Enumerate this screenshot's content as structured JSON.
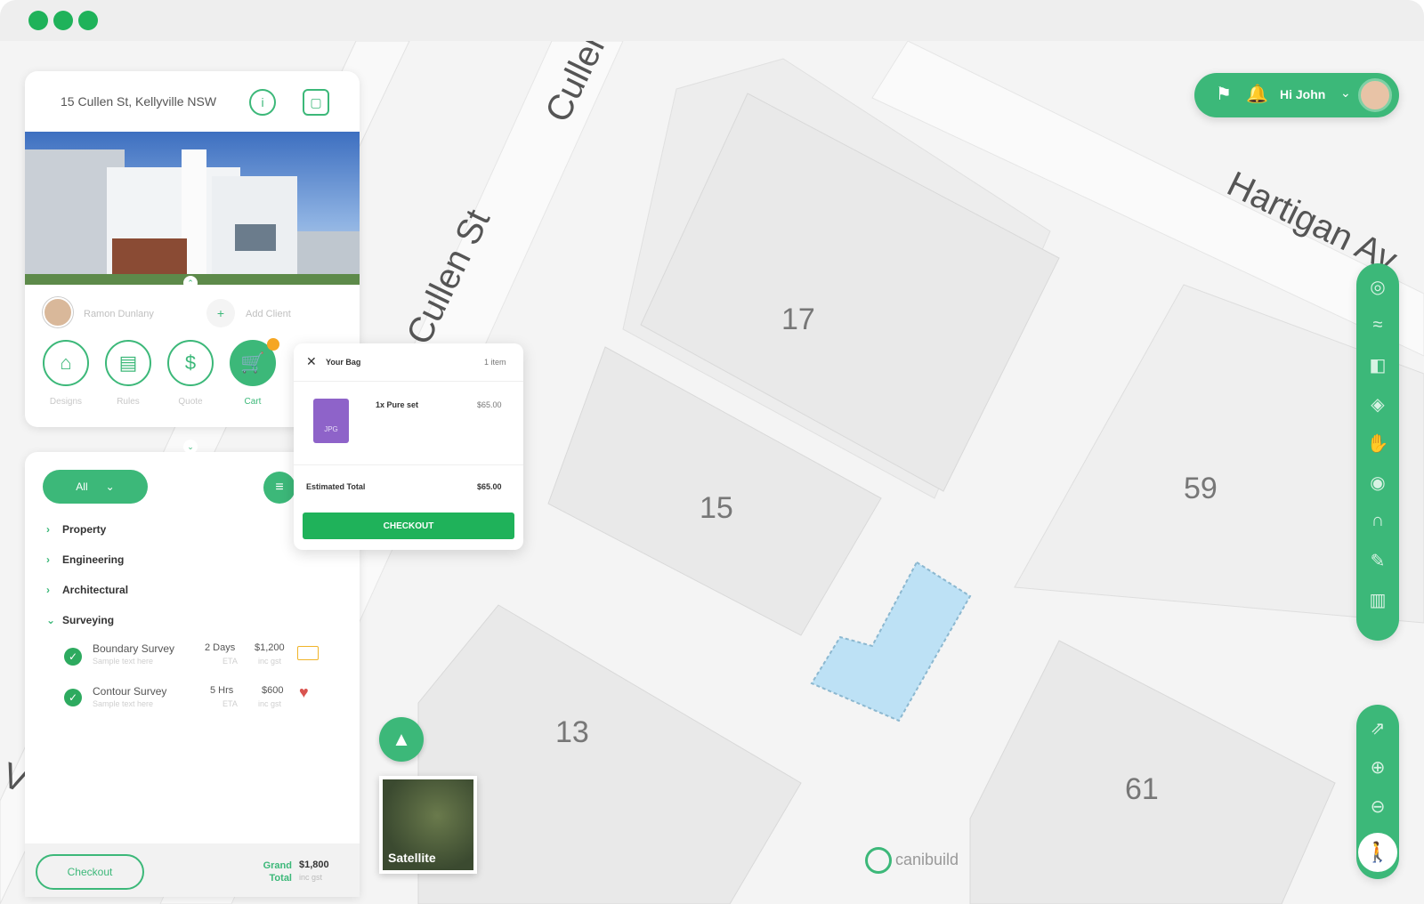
{
  "window": {
    "dots_color": "#1fb25a"
  },
  "map": {
    "streets": [
      "Cullen St",
      "Hartigan Av"
    ],
    "left_fragment": "V",
    "lots": [
      "17",
      "15",
      "59",
      "13",
      "61"
    ],
    "selected_lot_color": "#bde1f5",
    "accent": "#3cb879"
  },
  "property_panel": {
    "address": "15 Cullen St, Kellyville NSW",
    "agent_name": "Ramon Dunlany",
    "add_client_label": "Add Client",
    "tools": [
      {
        "label": "Designs",
        "icon": "house-icon"
      },
      {
        "label": "Rules",
        "icon": "clipboard-icon"
      },
      {
        "label": "Quote",
        "icon": "dollar-icon"
      },
      {
        "label": "Cart",
        "icon": "cart-icon"
      }
    ]
  },
  "services_panel": {
    "filter_label": "All",
    "categories": [
      "Property",
      "Engineering",
      "Architectural",
      "Surveying"
    ],
    "services": [
      {
        "name": "Boundary Survey",
        "sub": "Sample text here",
        "time": "2 Days",
        "time_sub": "ETA",
        "price": "$1,200",
        "price_sub": "inc gst"
      },
      {
        "name": "Contour Survey",
        "sub": "Sample text here",
        "time": "5 Hrs",
        "time_sub": "ETA",
        "price": "$600",
        "price_sub": "inc gst"
      }
    ],
    "checkout_label": "Checkout",
    "grand_label": "Grand Total",
    "grand_value": "$1,800",
    "grand_sub": "inc gst"
  },
  "bag": {
    "title": "Your Bag",
    "count": "1 item",
    "item_name": "1x Pure set",
    "item_price": "$65.00",
    "file_type": "JPG",
    "estimated_label": "Estimated Total",
    "estimated_value": "$65.00",
    "checkout_label": "CHECKOUT"
  },
  "user": {
    "greeting": "Hi John"
  },
  "satellite_label": "Satellite",
  "brand": "canibuild"
}
